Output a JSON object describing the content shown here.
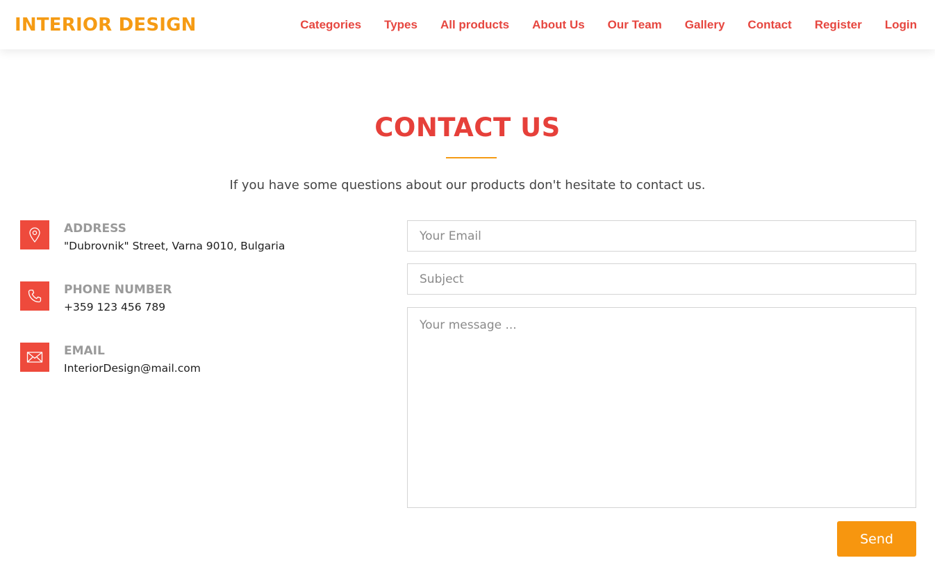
{
  "brand": {
    "name": "INTERIOR DESIGN"
  },
  "nav": {
    "items": [
      {
        "label": "Categories"
      },
      {
        "label": "Types"
      },
      {
        "label": "All products"
      },
      {
        "label": "About Us"
      },
      {
        "label": "Our Team"
      },
      {
        "label": "Gallery"
      },
      {
        "label": "Contact"
      },
      {
        "label": "Register"
      },
      {
        "label": "Login"
      }
    ]
  },
  "contact": {
    "title": "CONTACT US",
    "subtitle": "If you have some questions about our products don't hesitate to contact us.",
    "info": [
      {
        "icon": "map-pin-icon",
        "label": "ADDRESS",
        "value": "\"Dubrovnik\" Street, Varna 9010, Bulgaria"
      },
      {
        "icon": "phone-icon",
        "label": "PHONE NUMBER",
        "value": "+359 123 456 789"
      },
      {
        "icon": "envelope-icon",
        "label": "EMAIL",
        "value": "InteriorDesign@mail.com"
      }
    ]
  },
  "form": {
    "email_placeholder": "Your Email",
    "subject_placeholder": "Subject",
    "message_placeholder": "Your message ...",
    "send_label": "Send"
  },
  "colors": {
    "brand_orange": "#f59b14",
    "accent_red": "#e6463f",
    "icon_red": "#ee4a3c",
    "button_orange": "#f7960f"
  }
}
